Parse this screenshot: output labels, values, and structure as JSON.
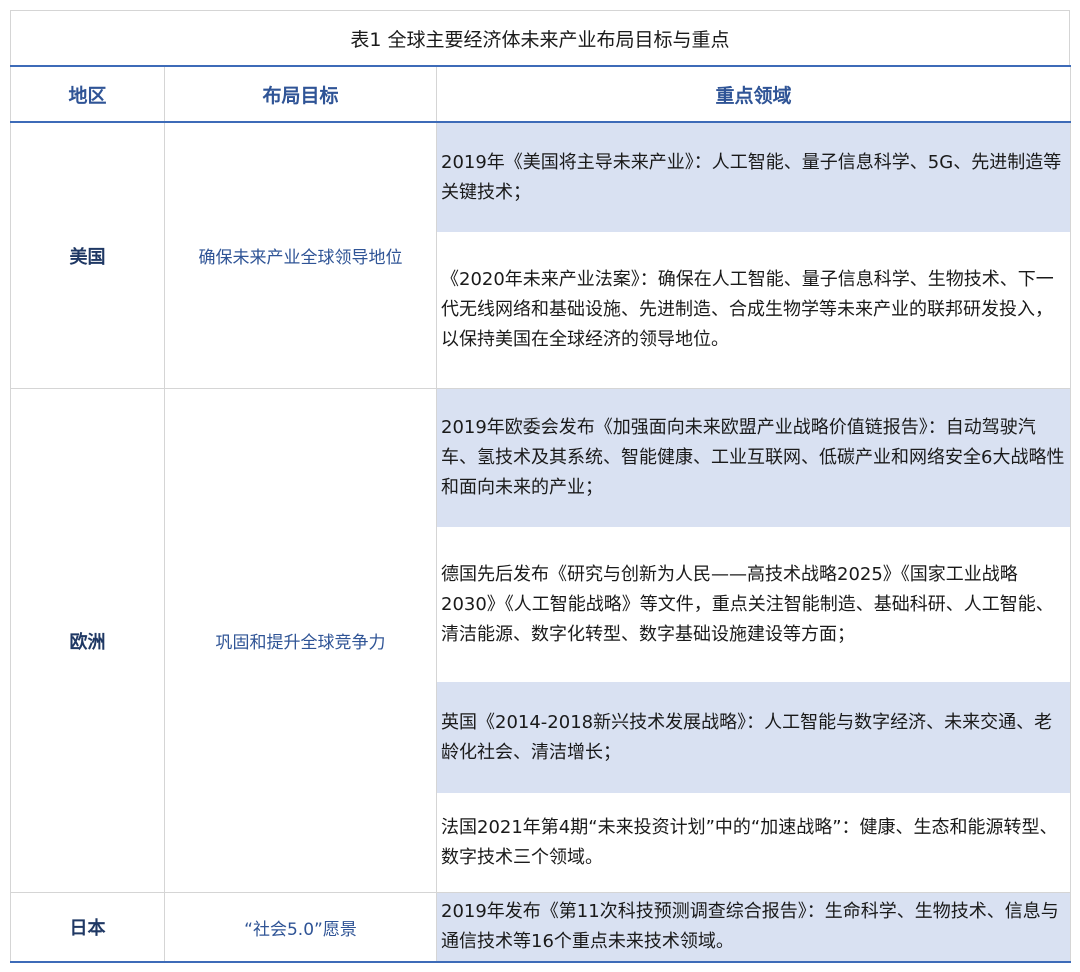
{
  "title": "表1 全球主要经济体未来产业布局目标与重点",
  "headers": {
    "region": "地区",
    "goal": "布局目标",
    "focus": "重点领域"
  },
  "rows": [
    {
      "region": "美国",
      "goal": "确保未来产业全球领导地位",
      "items": [
        "2019年《美国将主导未来产业》：人工智能、量子信息科学、5G、先进制造等关键技术；",
        "《2020年未来产业法案》：确保在人工智能、量子信息科学、生物技术、下一代无线网络和基础设施、先进制造、合成生物学等未来产业的联邦研发投入，以保持美国在全球经济的领导地位。"
      ]
    },
    {
      "region": "欧洲",
      "goal": "巩固和提升全球竞争力",
      "items": [
        "2019年欧委会发布《加强面向未来欧盟产业战略价值链报告》：自动驾驶汽车、氢技术及其系统、智能健康、工业互联网、低碳产业和网络安全6大战略性和面向未来的产业；",
        "德国先后发布《研究与创新为人民——高技术战略2025》《国家工业战略2030》《人工智能战略》等文件，重点关注智能制造、基础科研、人工智能、清洁能源、数字化转型、数字基础设施建设等方面；",
        "英国《2014-2018新兴技术发展战略》：人工智能与数字经济、未来交通、老龄化社会、清洁增长；",
        "法国2021年第4期“未来投资计划”中的“加速战略”：健康、生态和能源转型、数字技术三个领域。"
      ]
    },
    {
      "region": "日本",
      "goal": "“社会5.0”愿景",
      "items": [
        "2019年发布《第11次科技预测调查综合报告》：生命科学、生物技术、信息与通信技术等16个重点未来技术领域。"
      ]
    }
  ],
  "colors": {
    "header_text": "#2f5496",
    "rule": "#3d6bb8",
    "shade": "#d9e1f2"
  }
}
